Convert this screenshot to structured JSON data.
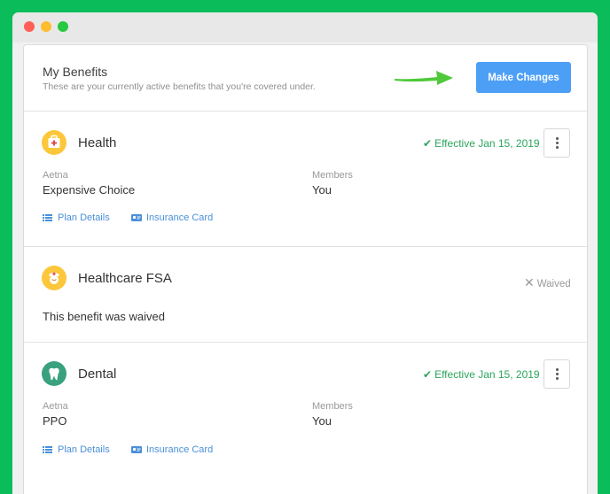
{
  "header": {
    "title": "My Benefits",
    "subtitle": "These are your currently active benefits that you're covered under.",
    "make_changes_label": "Make Changes"
  },
  "benefits": [
    {
      "name": "Health",
      "icon": "medical-kit-icon",
      "status": "Effective Jan 15, 2019",
      "carrier_label": "Aetna",
      "plan": "Expensive Choice",
      "members_label": "Members",
      "members": "You",
      "plan_details_label": "Plan Details",
      "insurance_card_label": "Insurance Card"
    },
    {
      "name": "Healthcare FSA",
      "icon": "nurse-icon",
      "status": "Waived",
      "message": "This benefit was waived"
    },
    {
      "name": "Dental",
      "icon": "tooth-icon",
      "status": "Effective Jan 15, 2019",
      "carrier_label": "Aetna",
      "plan": "PPO",
      "members_label": "Members",
      "members": "You",
      "plan_details_label": "Plan Details",
      "insurance_card_label": "Insurance Card"
    }
  ],
  "colors": {
    "background": "#0bbd5a",
    "accent": "#4d9ff5",
    "effective": "#2ba55c",
    "icon_yellow": "#fcc73b",
    "icon_teal": "#3aa17e"
  }
}
